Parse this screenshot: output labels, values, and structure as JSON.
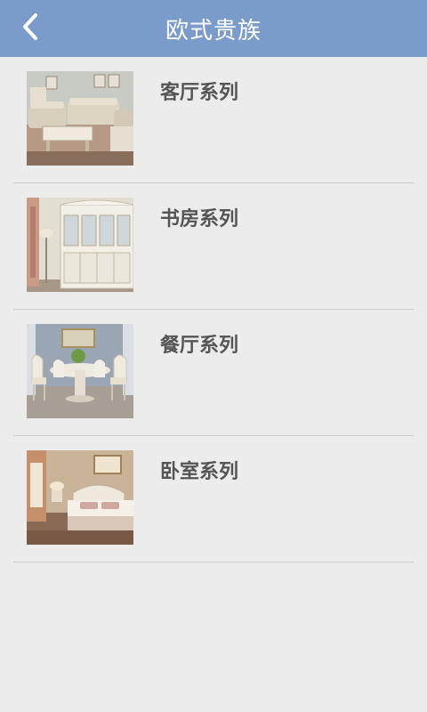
{
  "header": {
    "title": "欧式贵族",
    "back_icon": "chevron-left-icon"
  },
  "colors": {
    "header_bg": "#7b9ccb",
    "page_bg": "#ececec",
    "label_text": "#555555",
    "divider": "#c9c9c9"
  },
  "series": [
    {
      "label": "客厅系列",
      "image": "living-room-photo"
    },
    {
      "label": "书房系列",
      "image": "study-room-photo"
    },
    {
      "label": "餐厅系列",
      "image": "dining-room-photo"
    },
    {
      "label": "卧室系列",
      "image": "bedroom-photo"
    }
  ]
}
